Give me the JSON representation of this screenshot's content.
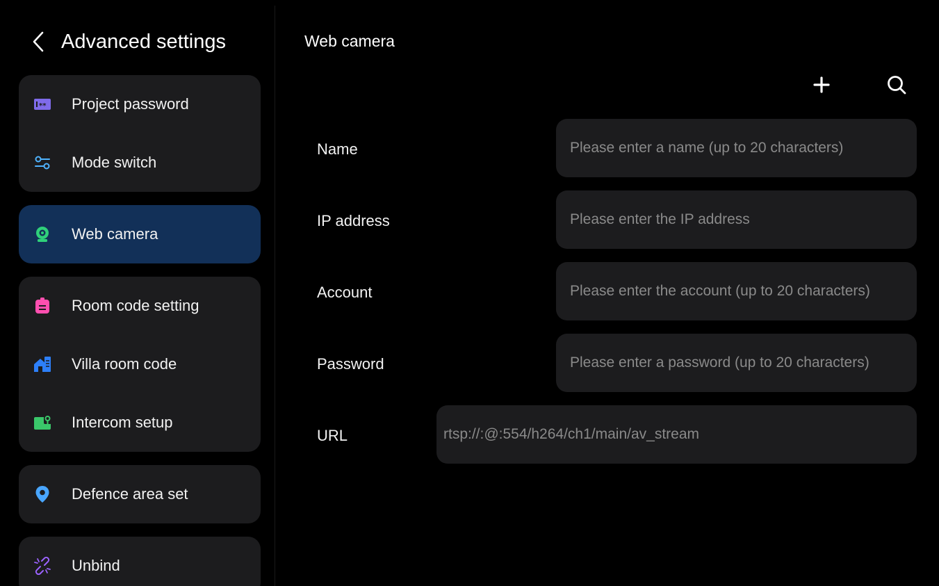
{
  "header": {
    "title": "Advanced settings"
  },
  "sidebar": {
    "items": [
      {
        "label": "Project password",
        "icon": "password-icon",
        "color": "#7f6bea"
      },
      {
        "label": "Mode switch",
        "icon": "sliders-icon",
        "color": "#4fb3ff"
      },
      {
        "label": "Web camera",
        "icon": "webcam-icon",
        "color": "#2fd07a",
        "active": true
      },
      {
        "label": "Room code setting",
        "icon": "clipboard-icon",
        "color": "#ff4fb0"
      },
      {
        "label": "Villa room code",
        "icon": "house-icon",
        "color": "#2d7ff9"
      },
      {
        "label": "Intercom setup",
        "icon": "intercom-icon",
        "color": "#3ac76a"
      },
      {
        "label": "Defence area set",
        "icon": "location-pin-icon",
        "color": "#49a6ff"
      },
      {
        "label": "Unbind",
        "icon": "unlink-icon",
        "color": "#9b63ff"
      }
    ]
  },
  "main": {
    "title": "Web camera",
    "toolbar": {
      "add_icon": "plus-icon",
      "search_icon": "search-icon"
    },
    "form": {
      "name": {
        "label": "Name",
        "placeholder": "Please enter a name (up to 20 characters)"
      },
      "ip": {
        "label": "IP address",
        "placeholder": "Please enter the IP address"
      },
      "account": {
        "label": "Account",
        "placeholder": "Please enter the account (up to 20 characters)"
      },
      "password": {
        "label": "Password",
        "placeholder": "Please enter a password (up to 20 characters)"
      },
      "url": {
        "label": "URL",
        "value": "rtsp://:@:554/h264/ch1/main/av_stream"
      }
    }
  },
  "colors": {
    "background": "#000000",
    "card": "#1c1c1e",
    "active_card": "#123058",
    "placeholder_text": "#8a8a8a"
  }
}
